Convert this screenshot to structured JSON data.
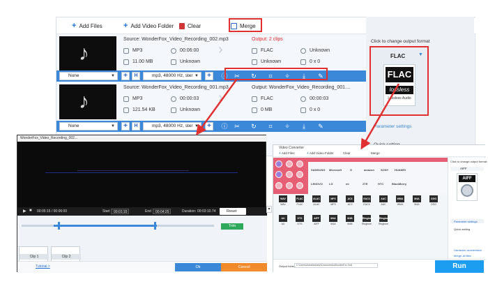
{
  "toolbar": {
    "add_files": "Add Files",
    "add_video_folder": "Add Video Folder",
    "clear": "Clear",
    "merge": "Merge"
  },
  "files": [
    {
      "source": "Source: WonderFox_Video_Recording_002.mp3",
      "format": "MP3",
      "duration": "00:06:00",
      "size": "11.00 MB",
      "resolution": "Unknown",
      "output": "Output: 2 clips",
      "out_format": "FLAC",
      "out_duration": "Unknown",
      "out_size": "Unknown",
      "out_res": "0 x 0",
      "subtitle": "None",
      "audio": "mp3, 48000 Hz, ster"
    },
    {
      "source": "Source: WonderFox_Video_Recording_001.mp3",
      "format": "MP3",
      "duration": "00:00:03",
      "size": "121.54 KB",
      "resolution": "Unknown",
      "output": "Output: WonderFox_Video_Recording_001....",
      "out_format": "FLAC",
      "out_duration": "00:00:03",
      "out_size": "0 MB",
      "out_res": "0 x 0",
      "subtitle": "None",
      "audio": "mp3, 48000 Hz, ster"
    }
  ],
  "side": {
    "title": "Click to change output format",
    "format": "FLAC",
    "logo_top": "FLAC",
    "logo_mid": "lossless",
    "logo_sub": "Lossless Audio",
    "param": "Parameter settings",
    "quick": "Quick setting"
  },
  "trim": {
    "title": "WonderFox_Video_Recording_002...",
    "time": "00:05:15 / 00:06:00",
    "start_label": "Start",
    "start": "00:01:15",
    "end_label": "End",
    "end": "00:04:25",
    "duration_label": "Duration:",
    "duration": "00:03:10.74",
    "reset": "Reset",
    "trim_btn": "Trim",
    "clip1": "Clip 1",
    "clip2": "Clip 2",
    "tutorial": "Tutorial >",
    "ok": "Ok",
    "cancel": "Cancel"
  },
  "conv": {
    "title": "Video Converter",
    "add_files": "Add Files",
    "add_video_folder": "Add Video Folder",
    "clear": "Clear",
    "merge": "Merge",
    "brands_row1": [
      "SAMSUNG",
      "Microsoft",
      "G",
      "amazon",
      "SONY",
      "HUAWEI"
    ],
    "brands_row2": [
      "LENOVO",
      "LG",
      "mi",
      "ZTE",
      "HTC",
      "BlackBerry"
    ],
    "formats_row1": [
      "WAV",
      "FLAC",
      "ALAC",
      "MP3",
      "AC3",
      "EAC3",
      "AAC",
      "WMA",
      "M4A",
      "OGG"
    ],
    "formats_row2": [
      "AU",
      "DTS",
      "AIFF",
      "M4A",
      "M4B",
      "Ringtone",
      "Ringtone"
    ],
    "right_title": "Click to change output format:",
    "right_format": "AIFF",
    "param": "Parameter settings",
    "quick": "Quick setting",
    "hw": "Hardware acceleration",
    "merge_all": "Merge all files",
    "output_label": "Output folder:",
    "output_path": "C:\\Users\\Administrator\\Documents\\WonderFox Soft",
    "run": "Run"
  },
  "colors": {
    "accent_blue": "#3c88d8",
    "highlight_red": "#e03030",
    "run_blue": "#1d9df0",
    "category_pink": "#e65f74"
  }
}
